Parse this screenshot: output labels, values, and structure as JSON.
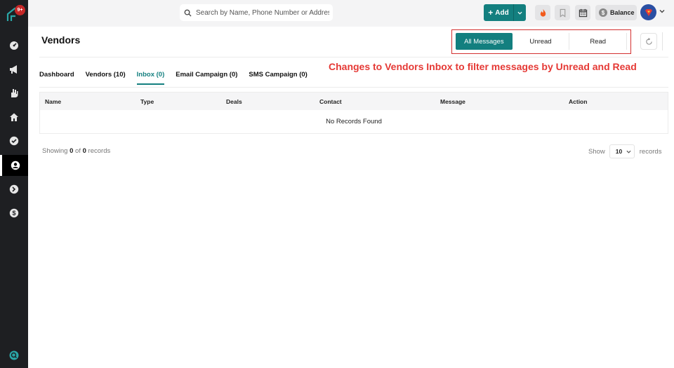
{
  "sidebar": {
    "notification_badge": "9+",
    "items": [
      {
        "icon": "gauge-icon",
        "name": "sidebar-item-dashboard"
      },
      {
        "icon": "megaphone-icon",
        "name": "sidebar-item-marketing"
      },
      {
        "icon": "hand-icon",
        "name": "sidebar-item-deals"
      },
      {
        "icon": "home-icon",
        "name": "sidebar-item-properties"
      },
      {
        "icon": "check-circle-icon",
        "name": "sidebar-item-tasks"
      },
      {
        "icon": "user-circle-icon",
        "name": "sidebar-item-contacts"
      },
      {
        "icon": "arrow-circle-icon",
        "name": "sidebar-item-transactions"
      },
      {
        "icon": "dollar-circle-icon",
        "name": "sidebar-item-billing"
      }
    ]
  },
  "header": {
    "search_placeholder": "Search by Name, Phone Number or Address a",
    "add_label": "Add",
    "balance_label": "Balance",
    "coin_symbol": "$"
  },
  "page": {
    "title": "Vendors",
    "filters": [
      "All Messages",
      "Unread",
      "Read"
    ],
    "active_filter": "All Messages",
    "annotation": "Changes to Vendors Inbox to filter messages by Unread and Read",
    "tabs": [
      "Dashboard",
      "Vendors (10)",
      "Inbox (0)",
      "Email Campaign (0)",
      "SMS Campaign (0)"
    ],
    "active_tab": "Inbox (0)"
  },
  "table": {
    "columns": [
      "Name",
      "Type",
      "Deals",
      "Contact",
      "Message",
      "Action"
    ],
    "empty_message": "No Records Found"
  },
  "footer": {
    "showing_prefix": "Showing",
    "showing_from": "0",
    "of_word": "of",
    "showing_total": "0",
    "records_word": "records",
    "show_label": "Show",
    "page_size": "10",
    "records_suffix": "records"
  },
  "colors": {
    "accent": "#137f7f",
    "sidebar": "#1e1f22",
    "annotation": "#e53935"
  }
}
